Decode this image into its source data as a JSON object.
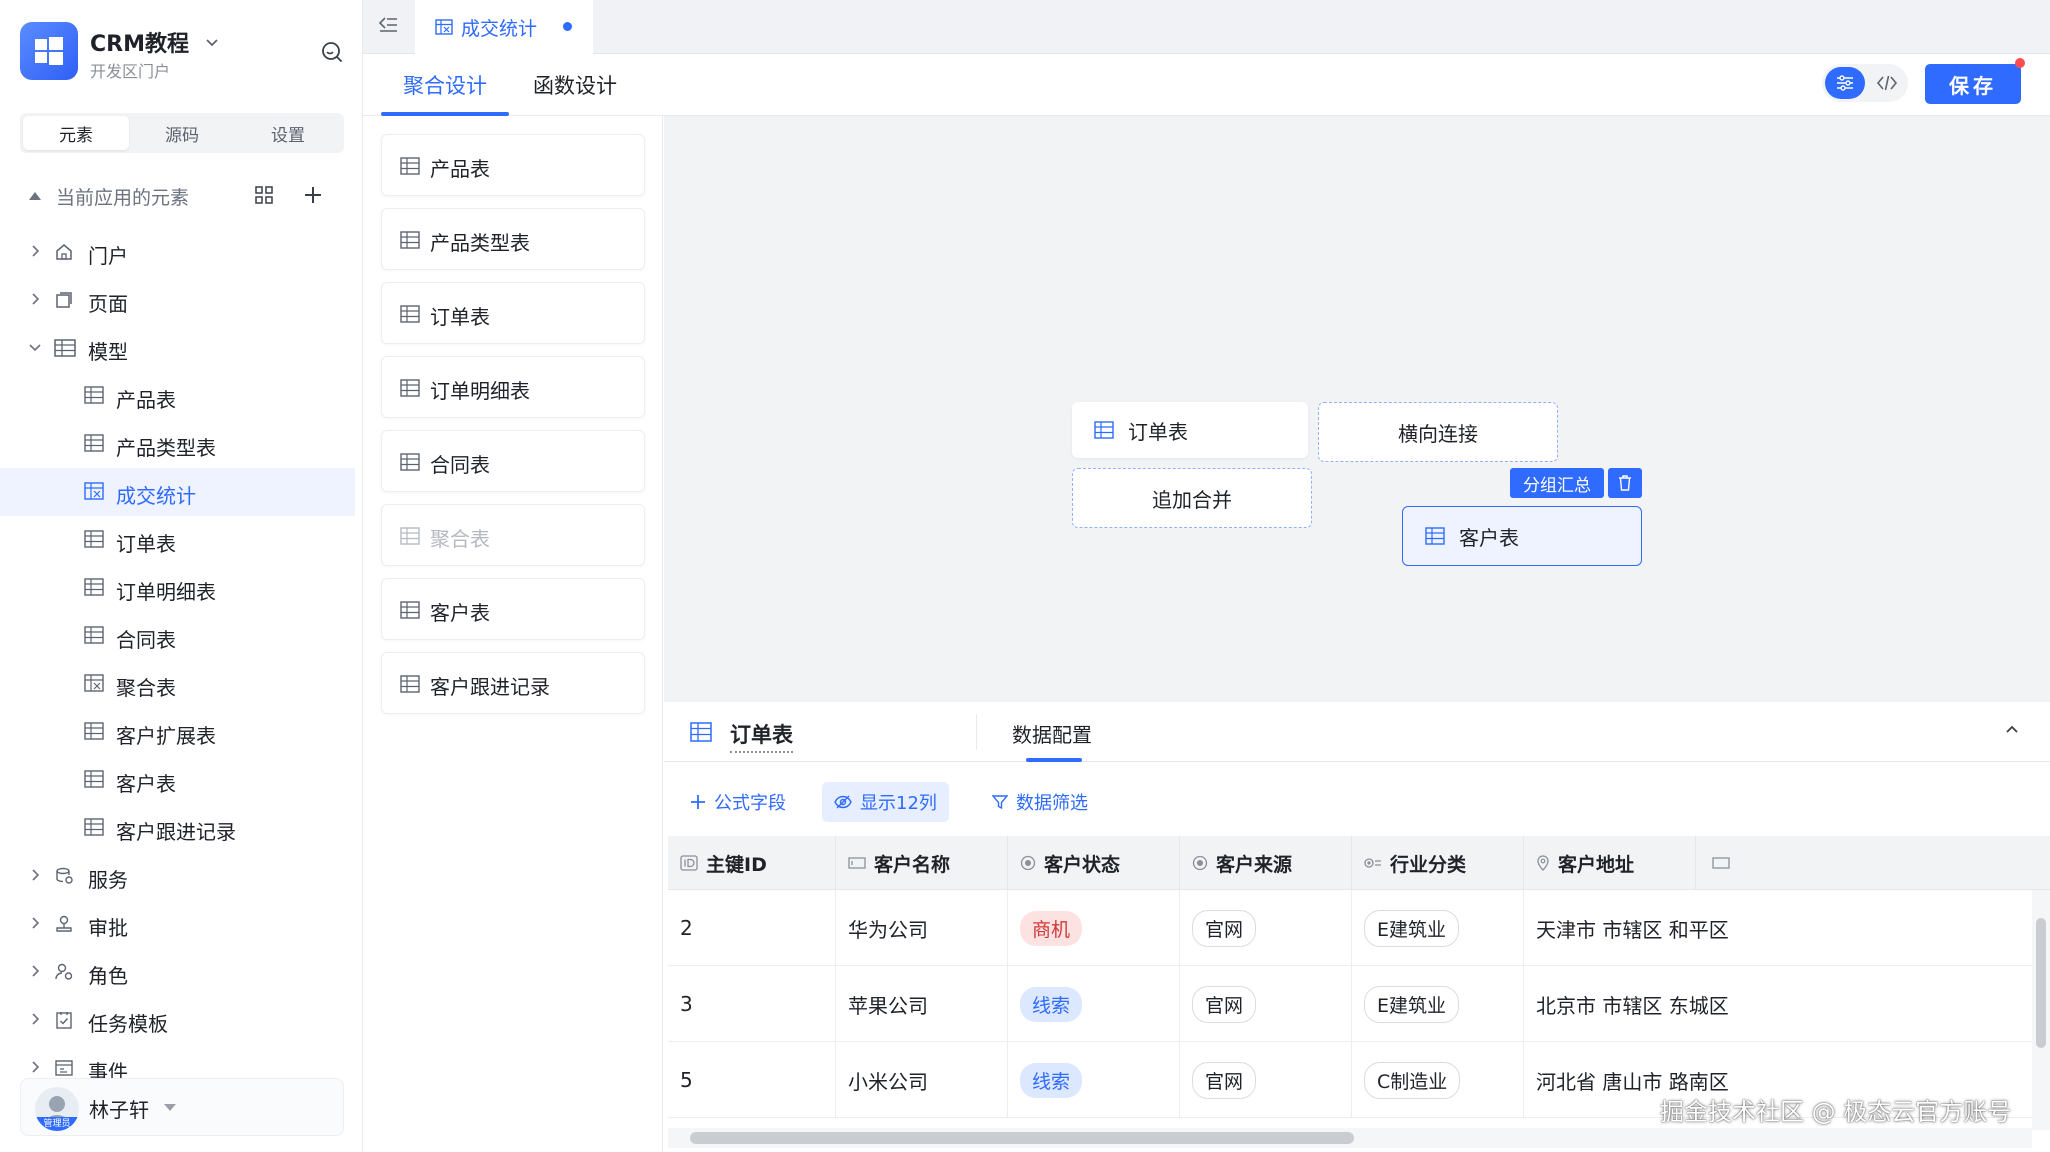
{
  "app": {
    "name": "CRM教程",
    "subtitle": "开发区门户"
  },
  "sidebar": {
    "segments": [
      {
        "label": "元素",
        "active": true
      },
      {
        "label": "源码",
        "active": false
      },
      {
        "label": "设置",
        "active": false
      }
    ],
    "section_label": "当前应用的元素",
    "tree": [
      {
        "label": "门户",
        "icon": "home-icon",
        "level": 0,
        "expanded": false
      },
      {
        "label": "页面",
        "icon": "page-icon",
        "level": 0,
        "expanded": false
      },
      {
        "label": "模型",
        "icon": "table-icon",
        "level": 0,
        "expanded": true
      },
      {
        "label": "产品表",
        "icon": "table-icon",
        "level": 1
      },
      {
        "label": "产品类型表",
        "icon": "table-icon",
        "level": 1
      },
      {
        "label": "成交统计",
        "icon": "aggregate-icon",
        "level": 1,
        "selected": true
      },
      {
        "label": "订单表",
        "icon": "table-icon",
        "level": 1
      },
      {
        "label": "订单明细表",
        "icon": "table-icon",
        "level": 1
      },
      {
        "label": "合同表",
        "icon": "table-icon",
        "level": 1
      },
      {
        "label": "聚合表",
        "icon": "aggregate-icon",
        "level": 1
      },
      {
        "label": "客户扩展表",
        "icon": "table-icon",
        "level": 1
      },
      {
        "label": "客户表",
        "icon": "table-icon",
        "level": 1
      },
      {
        "label": "客户跟进记录",
        "icon": "table-icon",
        "level": 1
      },
      {
        "label": "服务",
        "icon": "service-icon",
        "level": 0,
        "expanded": false
      },
      {
        "label": "审批",
        "icon": "approval-icon",
        "level": 0,
        "expanded": false
      },
      {
        "label": "角色",
        "icon": "role-icon",
        "level": 0,
        "expanded": false
      },
      {
        "label": "任务模板",
        "icon": "task-icon",
        "level": 0,
        "expanded": false
      },
      {
        "label": "事件",
        "icon": "event-icon",
        "level": 0,
        "expanded": false
      }
    ],
    "user": {
      "name": "林子轩",
      "role_tag": "管理员"
    }
  },
  "tabs": {
    "open_tab": "成交统计"
  },
  "design": {
    "tabs": [
      {
        "label": "聚合设计",
        "active": true
      },
      {
        "label": "函数设计",
        "active": false
      }
    ],
    "save_label": "保存"
  },
  "palette": [
    {
      "label": "产品表",
      "disabled": false
    },
    {
      "label": "产品类型表",
      "disabled": false
    },
    {
      "label": "订单表",
      "disabled": false
    },
    {
      "label": "订单明细表",
      "disabled": false
    },
    {
      "label": "合同表",
      "disabled": false
    },
    {
      "label": "聚合表",
      "disabled": true
    },
    {
      "label": "客户表",
      "disabled": false
    },
    {
      "label": "客户跟进记录",
      "disabled": false
    }
  ],
  "canvas": {
    "node_orders": "订单表",
    "node_join": "横向连接",
    "node_append": "追加合并",
    "badge_group": "分组汇总",
    "node_customers": "客户表"
  },
  "data_panel": {
    "title": "订单表",
    "tab": "数据配置",
    "tools": {
      "formula": "公式字段",
      "show_columns": "显示12列",
      "filter": "数据筛选"
    },
    "columns": [
      {
        "label": "主键ID",
        "icon": "id-icon"
      },
      {
        "label": "客户名称",
        "icon": "text-field-icon"
      },
      {
        "label": "客户状态",
        "icon": "radio-icon"
      },
      {
        "label": "客户来源",
        "icon": "radio-icon"
      },
      {
        "label": "行业分类",
        "icon": "tag-select-icon"
      },
      {
        "label": "客户地址",
        "icon": "location-icon"
      }
    ],
    "rows": [
      {
        "id": "2",
        "name": "华为公司",
        "status": "商机",
        "status_tone": "red",
        "source": "官网",
        "industry": "E建筑业",
        "address": "天津市 市辖区 和平区"
      },
      {
        "id": "3",
        "name": "苹果公司",
        "status": "线索",
        "status_tone": "blue",
        "source": "官网",
        "industry": "E建筑业",
        "address": "北京市 市辖区 东城区"
      },
      {
        "id": "5",
        "name": "小米公司",
        "status": "线索",
        "status_tone": "blue",
        "source": "官网",
        "industry": "C制造业",
        "address": "河北省 唐山市 路南区"
      }
    ]
  },
  "watermark": "掘金技术社区 @ 极态云官方账号",
  "colors": {
    "accent": "#2f6bff",
    "danger": "#ff4d4f",
    "canvas_bg": "#f2f3f5"
  }
}
